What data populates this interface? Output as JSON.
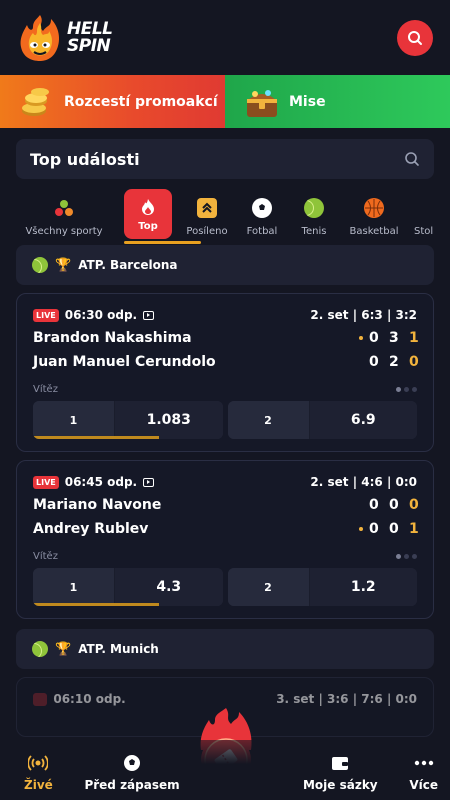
{
  "header": {
    "logo_line1": "HELL",
    "logo_line2": "SPIN"
  },
  "promo": {
    "left_label": "Rozcestí promoakcí",
    "right_label": "Mise"
  },
  "top_events": {
    "title": "Top události"
  },
  "sport_tabs": [
    {
      "label": "Všechny sporty",
      "icon": "all-sports-icon"
    },
    {
      "label": "Top",
      "icon": "flame-icon",
      "active": true
    },
    {
      "label": "Posíleno",
      "icon": "boost-icon"
    },
    {
      "label": "Fotbal",
      "icon": "football-icon"
    },
    {
      "label": "Tenis",
      "icon": "tennis-icon"
    },
    {
      "label": "Basketbal",
      "icon": "basketball-icon"
    },
    {
      "label": "Stol",
      "icon": "table-tennis-icon"
    }
  ],
  "leagues": [
    {
      "name": "ATP. Barcelona"
    },
    {
      "name": "ATP. Munich"
    }
  ],
  "matches": [
    {
      "live": "LIVE",
      "time": "06:30 odp.",
      "status": "2. set  |  6:3  |  3:2",
      "p1": "Brandon Nakashima",
      "p2": "Juan Manuel Cerundolo",
      "p1_scores": [
        "0",
        "3",
        "1"
      ],
      "p2_scores": [
        "0",
        "2",
        "0"
      ],
      "market": "Vítěz",
      "odd1_label": "1",
      "odd1_value": "1.083",
      "odd2_label": "2",
      "odd2_value": "6.9"
    },
    {
      "live": "LIVE",
      "time": "06:45 odp.",
      "status": "2. set  |  4:6  |  0:0",
      "p1": "Mariano Navone",
      "p2": "Andrey Rublev",
      "p1_scores": [
        "0",
        "0",
        "0"
      ],
      "p2_scores": [
        "0",
        "0",
        "1"
      ],
      "market": "Vítěz",
      "odd1_label": "1",
      "odd1_value": "4.3",
      "odd2_label": "2",
      "odd2_value": "1.2"
    },
    {
      "time": "06:10 odp.",
      "status": "3. set  |  3:6  |  7:6  |  0:0"
    }
  ],
  "bottom_nav": {
    "live": "Živé",
    "prematch": "Před zápasem",
    "my_bets": "Moje sázky",
    "more": "Více"
  },
  "colors": {
    "accent": "#e8343a",
    "gold": "#f2b33d",
    "green": "#2ec95b"
  }
}
